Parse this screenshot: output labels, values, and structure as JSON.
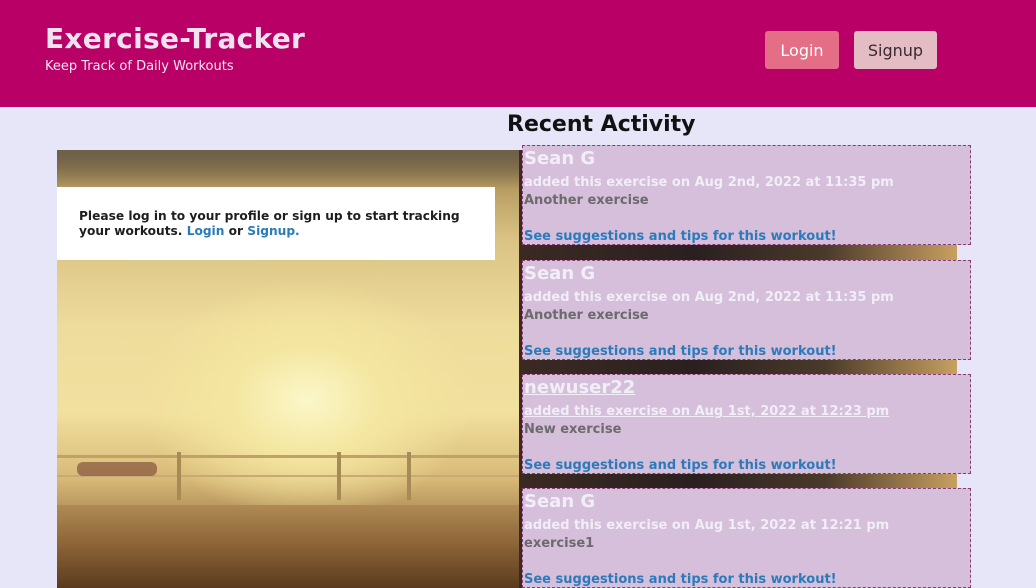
{
  "header": {
    "title": "Exercise-Tracker",
    "subtitle": "Keep Track of Daily Workouts",
    "login_label": "Login",
    "signup_label": "Signup"
  },
  "recent": {
    "heading": "Recent Activity"
  },
  "info": {
    "message": "Please log in to your profile or sign up to start tracking your workouts.",
    "login_link": "Login",
    "or_text": "or",
    "signup_link": "Signup."
  },
  "activities": [
    {
      "user": "Sean G",
      "meta": "added this exercise on Aug 2nd, 2022 at 11:35 pm",
      "exercise": "Another exercise",
      "tips": "See suggestions and tips for this workout!"
    },
    {
      "user": "Sean G",
      "meta": "added this exercise on Aug 2nd, 2022 at 11:35 pm",
      "exercise": "Another exercise",
      "tips": "See suggestions and tips for this workout!"
    },
    {
      "user": "newuser22",
      "meta": "added this exercise on Aug 1st, 2022 at 12:23 pm",
      "exercise": "New exercise",
      "tips": "See suggestions and tips for this workout!"
    },
    {
      "user": "Sean G",
      "meta": "added this exercise on Aug 1st, 2022 at 12:21 pm",
      "exercise": "exercise1",
      "tips": "See suggestions and tips for this workout!"
    }
  ],
  "colors": {
    "header_bg": "#b80066",
    "page_bg": "#e6e6f8",
    "card_bg": "#d5bfdb",
    "link": "#2b7bbb",
    "login_button": "#e46e86",
    "signup_button": "#e4bcc4"
  }
}
